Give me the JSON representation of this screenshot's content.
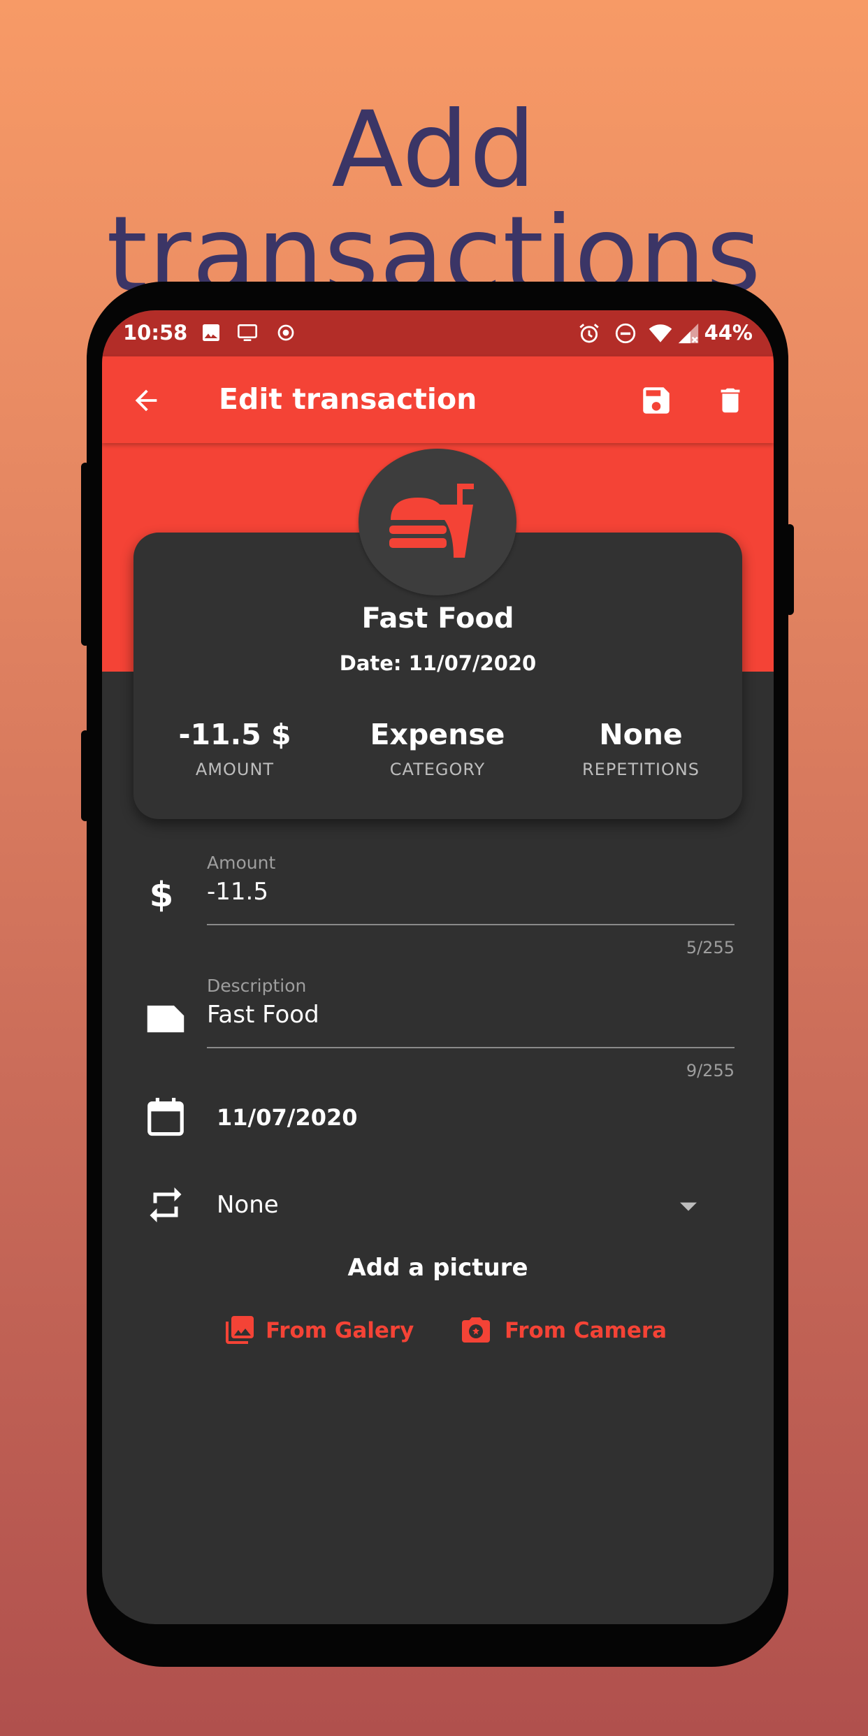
{
  "headline": "Add transactions",
  "statusbar": {
    "time": "10:58",
    "battery": "44%",
    "left_icons": [
      "image-icon",
      "cast-icon",
      "record-icon"
    ],
    "right_icons": [
      "alarm-icon",
      "dnd-icon",
      "wifi-icon",
      "signal-icon"
    ]
  },
  "appbar": {
    "title": "Edit transaction",
    "icons": [
      "back-arrow-icon",
      "save-icon",
      "delete-icon"
    ]
  },
  "card": {
    "icon": "fast-food-icon",
    "name": "Fast Food",
    "date": "Date: 11/07/2020",
    "stats": [
      {
        "value": "-11.5 $",
        "label": "AMOUNT"
      },
      {
        "value": "Expense",
        "label": "CATEGORY"
      },
      {
        "value": "None",
        "label": "REPETITIONS"
      }
    ]
  },
  "form": {
    "amount": {
      "label": "Amount",
      "value": "-11.5",
      "counter": "5/255"
    },
    "description": {
      "label": "Description",
      "value": "Fast Food",
      "counter": "9/255"
    },
    "date": {
      "value": "11/07/2020"
    },
    "repetition": {
      "value": "None"
    }
  },
  "picture": {
    "title": "Add a picture",
    "gallery_label": "From Galery",
    "camera_label": "From Camera"
  },
  "colors": {
    "accent": "#f44336",
    "statusbar": "#b32d28",
    "surface": "#303030",
    "card": "#323232",
    "headline": "#3b3566"
  }
}
